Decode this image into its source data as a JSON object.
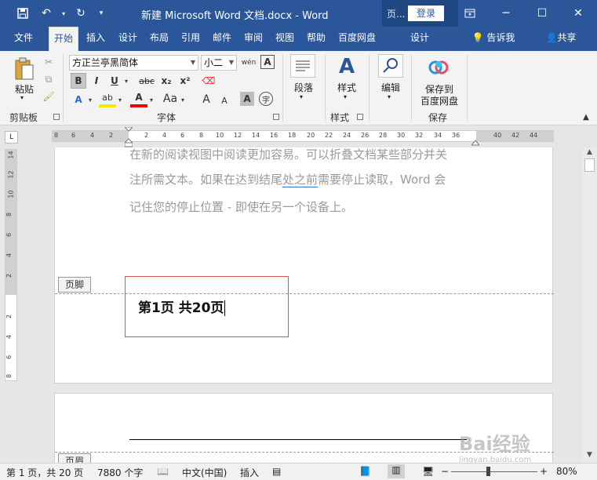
{
  "titlebar": {
    "title": "新建 Microsoft Word 文档.docx  -  Word",
    "context_label": "页...",
    "login": "登录",
    "qa_save_icon": "save-icon",
    "qa_undo_icon": "undo-icon",
    "qa_redo_icon": "redo-icon"
  },
  "tabs": [
    {
      "label": "文件"
    },
    {
      "label": "开始"
    },
    {
      "label": "插入"
    },
    {
      "label": "设计"
    },
    {
      "label": "布局"
    },
    {
      "label": "引用"
    },
    {
      "label": "邮件"
    },
    {
      "label": "审阅"
    },
    {
      "label": "视图"
    },
    {
      "label": "帮助"
    },
    {
      "label": "百度网盘"
    },
    {
      "label": "设计"
    },
    {
      "label": "告诉我"
    },
    {
      "label": "共享"
    }
  ],
  "ribbon": {
    "clipboard": {
      "paste": "粘贴",
      "group": "剪贴板"
    },
    "font": {
      "name": "方正兰亭黑简体",
      "size": "小二",
      "group": "字体",
      "bold": "B",
      "italic": "I",
      "underline": "U",
      "strike": "abc",
      "sub": "x₂",
      "sup": "x²",
      "grow": "A",
      "shrink": "A",
      "aa": "Aa",
      "phonetic": "wén",
      "char_border": "A",
      "char_shade": "A",
      "enclose": "字"
    },
    "paragraph": {
      "label": "段落"
    },
    "styles": {
      "label": "样式",
      "group": "样式"
    },
    "editing": {
      "label": "编辑"
    },
    "save": {
      "line1": "保存到",
      "line2": "百度网盘",
      "group": "保存"
    }
  },
  "ruler": {
    "h_numbers": [
      "8",
      "6",
      "4",
      "2",
      "2",
      "4",
      "6",
      "8",
      "10",
      "12",
      "14",
      "16",
      "18",
      "20",
      "22",
      "24",
      "26",
      "28",
      "30",
      "32",
      "34",
      "36",
      "40",
      "42",
      "44"
    ],
    "v_numbers": [
      "14",
      "12",
      "10",
      "8",
      "6",
      "4",
      "2",
      "2",
      "4",
      "6",
      "8"
    ],
    "tab_selector": "L"
  },
  "document": {
    "line1": "在新的阅读视图中阅读更加容易。可以折叠文档某些部分并关",
    "line2_pre": "注所需文本。如果在达到结尾",
    "line2_ul": "处之前",
    "line2_post": "需要停止读取，Word 会",
    "line3": "记住您的停止位置 - 即使在另一个设备上。",
    "footer_tag": "页脚",
    "page_number_text": "第1页  共20页",
    "next_header_tag": "页眉"
  },
  "statusbar": {
    "page": "第 1 页，共 20 页",
    "words": "7880 个字",
    "lang": "中文(中国)",
    "mode": "插入",
    "zoom": "80%",
    "minus": "−",
    "plus": "+"
  },
  "watermark": {
    "main": "Bai经验",
    "sub": "jingyan.baidu.com"
  }
}
